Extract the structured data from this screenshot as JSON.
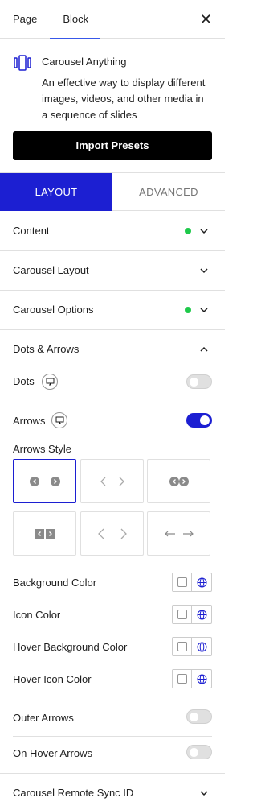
{
  "header": {
    "tabs": [
      "Page",
      "Block"
    ],
    "active_tab": "Block",
    "close_symbol": "✕"
  },
  "block": {
    "title": "Carousel Anything",
    "description": "An effective way to display different images, videos, and other media in a sequence of slides",
    "icon": "carousel-icon"
  },
  "import_button": "Import Presets",
  "mode_tabs": {
    "layout": "LAYOUT",
    "advanced": "ADVANCED",
    "active": "LAYOUT"
  },
  "sections": {
    "content": "Content",
    "carousel_layout": "Carousel Layout",
    "carousel_options": "Carousel Options",
    "dots_arrows": "Dots & Arrows",
    "remote_sync": "Carousel Remote Sync ID"
  },
  "dots_arrows": {
    "dots_label": "Dots",
    "dots_enabled": false,
    "arrows_label": "Arrows",
    "arrows_enabled": true,
    "arrows_style_label": "Arrows Style",
    "selected_style": 1,
    "colors": [
      {
        "label": "Background Color"
      },
      {
        "label": "Icon Color"
      },
      {
        "label": "Hover Background Color"
      },
      {
        "label": "Hover Icon Color"
      }
    ],
    "outer_arrows_label": "Outer Arrows",
    "outer_arrows_enabled": false,
    "on_hover_arrows_label": "On Hover Arrows",
    "on_hover_arrows_enabled": false
  },
  "colors": {
    "accent": "#1c1fd2",
    "status_dot": "#1ec94a",
    "tab_underline": "#3858e9"
  }
}
